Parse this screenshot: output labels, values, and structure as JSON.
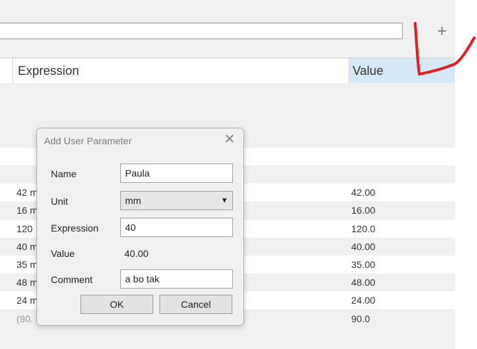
{
  "toolbar": {
    "search_value": "",
    "add_icon": "plus-icon",
    "add_glyph": "+"
  },
  "table": {
    "columns": [
      "Expression",
      "Value"
    ],
    "rows": [
      {
        "expression": "",
        "value": ""
      },
      {
        "expression": "",
        "value": ""
      },
      {
        "expression": "42 m",
        "value": "42.00"
      },
      {
        "expression": "16 m",
        "value": "16.00"
      },
      {
        "expression": "120",
        "value": "120.0"
      },
      {
        "expression": "40 m",
        "value": "40.00"
      },
      {
        "expression": "35 m",
        "value": "35.00"
      },
      {
        "expression": "48 m",
        "value": "48.00"
      },
      {
        "expression": "24 m",
        "value": "24.00"
      },
      {
        "expression": "(90.",
        "value": "90.0"
      }
    ]
  },
  "dialog": {
    "title": "Add User Parameter",
    "close_glyph": "✕",
    "name_label": "Name",
    "name_value": "Paula",
    "unit_label": "Unit",
    "unit_value": "mm",
    "unit_arrow": "▼",
    "expression_label": "Expression",
    "expression_value": "40",
    "value_label": "Value",
    "value_value": "40.00",
    "comment_label": "Comment",
    "comment_value": "a bo tak",
    "ok_label": "OK",
    "cancel_label": "Cancel"
  },
  "colors": {
    "annotation": "#e02020",
    "selected_header": "#d6e7f6"
  }
}
